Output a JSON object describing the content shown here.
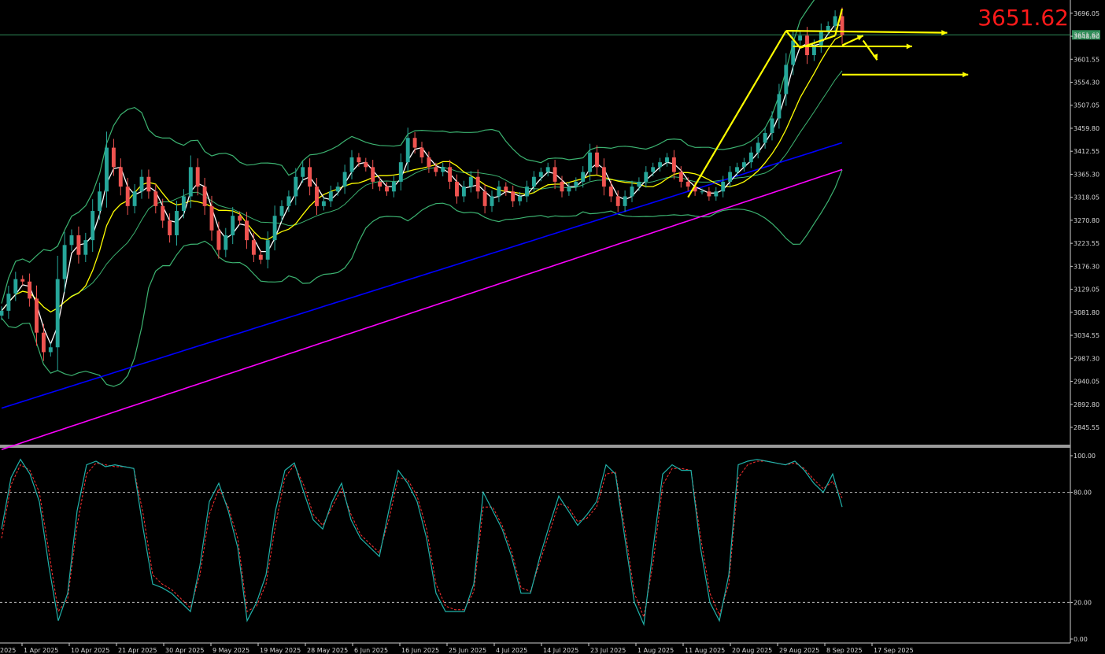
{
  "header": {
    "big_price": "3651.62"
  },
  "colors": {
    "background": "#000000",
    "bull_candle": "#26a69a",
    "bear_candle": "#ef5350",
    "ma_fast": "#ffffff",
    "ma_mid": "#ffff00",
    "ma_slow": "#0000ff",
    "ma_long": "#ff00ff",
    "bollinger": "#3cb371",
    "stoch_main": "#20b2aa",
    "stoch_signal": "#ff3030",
    "annotation": "#ffff00",
    "price_line": "#2e8b57",
    "big_price": "#ff1a1a"
  },
  "chart_data": [
    {
      "type": "candlestick",
      "title": "",
      "current_price": 3651.62,
      "current_price_label": "3651.62",
      "y_ticks": [
        "3696.05",
        "3648.80",
        "3601.55",
        "3554.30",
        "3507.05",
        "3459.80",
        "3412.55",
        "3365.30",
        "3318.05",
        "3270.80",
        "3223.55",
        "3176.30",
        "3129.05",
        "3081.80",
        "3034.55",
        "2987.30",
        "2940.05",
        "2892.80",
        "2845.55"
      ],
      "ylim": [
        2810,
        3720
      ],
      "x_labels": [
        "1 Apr 2025",
        "10 Apr 2025",
        "21 Apr 2025",
        "30 Apr 2025",
        "9 May 2025",
        "19 May 2025",
        "28 May 2025",
        "6 Jun 2025",
        "16 Jun 2025",
        "25 Jun 2025",
        "4 Jul 2025",
        "14 Jul 2025",
        "23 Jul 2025",
        "1 Aug 2025",
        "11 Aug 2025",
        "20 Aug 2025",
        "29 Aug 2025",
        "8 Sep 2025",
        "17 Sep 2025"
      ],
      "x_label_first_partial": "2025",
      "close": [
        3085,
        3120,
        3150,
        3145,
        3110,
        3040,
        3000,
        3010,
        3150,
        3220,
        3240,
        3200,
        3230,
        3290,
        3330,
        3420,
        3380,
        3340,
        3300,
        3330,
        3360,
        3330,
        3300,
        3270,
        3240,
        3290,
        3320,
        3380,
        3340,
        3300,
        3250,
        3210,
        3240,
        3280,
        3270,
        3230,
        3200,
        3190,
        3230,
        3280,
        3300,
        3320,
        3360,
        3380,
        3340,
        3300,
        3310,
        3330,
        3340,
        3370,
        3400,
        3390,
        3380,
        3350,
        3340,
        3330,
        3350,
        3390,
        3440,
        3420,
        3400,
        3380,
        3370,
        3380,
        3350,
        3320,
        3340,
        3360,
        3330,
        3300,
        3320,
        3340,
        3330,
        3310,
        3320,
        3340,
        3360,
        3370,
        3380,
        3350,
        3330,
        3340,
        3350,
        3370,
        3410,
        3380,
        3340,
        3320,
        3300,
        3320,
        3340,
        3350,
        3370,
        3380,
        3390,
        3400,
        3370,
        3350,
        3340,
        3330,
        3330,
        3320,
        3330,
        3350,
        3370,
        3380,
        3390,
        3410,
        3430,
        3450,
        3480,
        3530,
        3590,
        3640,
        3650,
        3610,
        3630,
        3660,
        3670,
        3690,
        3651
      ],
      "stochastic": {
        "ylim": [
          0,
          100
        ],
        "levels": [
          80,
          20
        ],
        "y_ticks": [
          "100.00",
          "80.00",
          "20.00",
          "0.00"
        ],
        "main": [
          60,
          88,
          98,
          90,
          75,
          40,
          10,
          25,
          70,
          95,
          97,
          94,
          95,
          94,
          93,
          60,
          30,
          28,
          25,
          20,
          15,
          40,
          75,
          85,
          70,
          50,
          10,
          20,
          35,
          70,
          92,
          96,
          80,
          65,
          60,
          75,
          85,
          65,
          55,
          50,
          45,
          70,
          92,
          85,
          75,
          55,
          25,
          15,
          15,
          15,
          30,
          80,
          70,
          60,
          45,
          25,
          25,
          45,
          62,
          78,
          70,
          62,
          68,
          75,
          95,
          90,
          55,
          20,
          8,
          50,
          90,
          95,
          92,
          92,
          50,
          20,
          10,
          35,
          95,
          97,
          98,
          97,
          96,
          95,
          97,
          92,
          85,
          80,
          90,
          72
        ],
        "signal": [
          55,
          84,
          95,
          92,
          80,
          48,
          15,
          22,
          62,
          90,
          96,
          95,
          94,
          94,
          93,
          68,
          35,
          30,
          27,
          22,
          17,
          35,
          68,
          82,
          72,
          55,
          15,
          18,
          30,
          62,
          88,
          95,
          84,
          68,
          62,
          72,
          82,
          68,
          57,
          52,
          47,
          65,
          88,
          87,
          78,
          60,
          30,
          18,
          16,
          16,
          26,
          72,
          72,
          62,
          48,
          28,
          26,
          42,
          58,
          74,
          72,
          64,
          66,
          72,
          90,
          91,
          60,
          25,
          12,
          42,
          84,
          93,
          93,
          92,
          56,
          25,
          13,
          30,
          88,
          95,
          97,
          97,
          96,
          95,
          96,
          93,
          87,
          82,
          86,
          77
        ]
      }
    }
  ]
}
